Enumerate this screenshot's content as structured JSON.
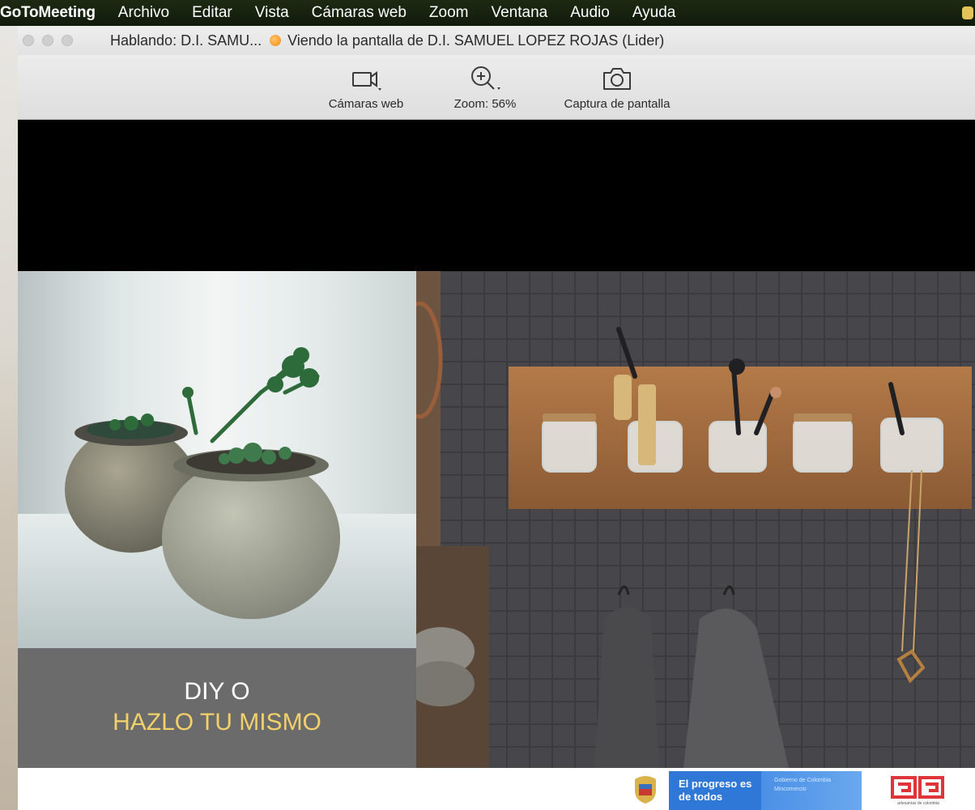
{
  "menubar": {
    "app": "GoToMeeting",
    "items": [
      "Archivo",
      "Editar",
      "Vista",
      "Cámaras web",
      "Zoom",
      "Ventana",
      "Audio",
      "Ayuda"
    ]
  },
  "titlebar": {
    "speaking": "Hablando: D.I. SAMU...",
    "viewing": "Viendo la pantalla de D.I. SAMUEL LOPEZ ROJAS (Lider)"
  },
  "toolbar": {
    "webcams_label": "Cámaras web",
    "zoom_label": "Zoom: 56%",
    "screenshot_label": "Captura de pantalla"
  },
  "slide": {
    "caption_line1": "DIY O",
    "caption_line2": "HAZLO TU MISMO"
  },
  "footer": {
    "progreso_text": "El progreso es de todos",
    "gov_text": "Gobierno de Colombia Mincomercio",
    "logo_text": "artesanías de colombia"
  },
  "colors": {
    "menubar": "#151f0e",
    "caption_bg": "#6b6b6b",
    "caption_accent": "#f2d06a",
    "speaking_dot": "#f08a15"
  }
}
